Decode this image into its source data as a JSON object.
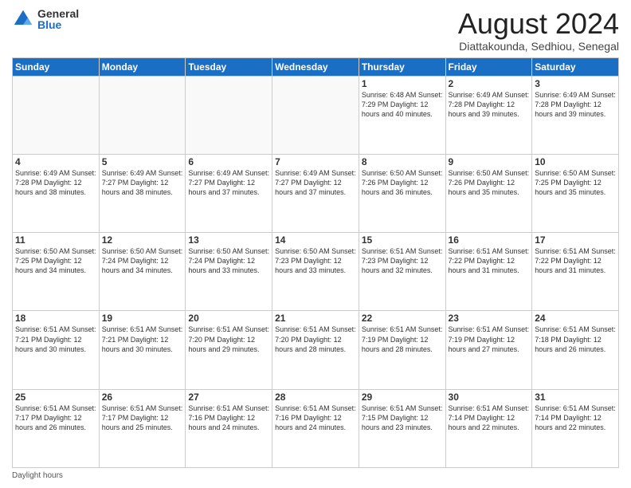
{
  "logo": {
    "general": "General",
    "blue": "Blue"
  },
  "title": "August 2024",
  "subtitle": "Diattakounda, Sedhiou, Senegal",
  "days_of_week": [
    "Sunday",
    "Monday",
    "Tuesday",
    "Wednesday",
    "Thursday",
    "Friday",
    "Saturday"
  ],
  "footer_label": "Daylight hours",
  "weeks": [
    [
      {
        "day": "",
        "info": ""
      },
      {
        "day": "",
        "info": ""
      },
      {
        "day": "",
        "info": ""
      },
      {
        "day": "",
        "info": ""
      },
      {
        "day": "1",
        "info": "Sunrise: 6:48 AM\nSunset: 7:29 PM\nDaylight: 12 hours\nand 40 minutes."
      },
      {
        "day": "2",
        "info": "Sunrise: 6:49 AM\nSunset: 7:28 PM\nDaylight: 12 hours\nand 39 minutes."
      },
      {
        "day": "3",
        "info": "Sunrise: 6:49 AM\nSunset: 7:28 PM\nDaylight: 12 hours\nand 39 minutes."
      }
    ],
    [
      {
        "day": "4",
        "info": "Sunrise: 6:49 AM\nSunset: 7:28 PM\nDaylight: 12 hours\nand 38 minutes."
      },
      {
        "day": "5",
        "info": "Sunrise: 6:49 AM\nSunset: 7:27 PM\nDaylight: 12 hours\nand 38 minutes."
      },
      {
        "day": "6",
        "info": "Sunrise: 6:49 AM\nSunset: 7:27 PM\nDaylight: 12 hours\nand 37 minutes."
      },
      {
        "day": "7",
        "info": "Sunrise: 6:49 AM\nSunset: 7:27 PM\nDaylight: 12 hours\nand 37 minutes."
      },
      {
        "day": "8",
        "info": "Sunrise: 6:50 AM\nSunset: 7:26 PM\nDaylight: 12 hours\nand 36 minutes."
      },
      {
        "day": "9",
        "info": "Sunrise: 6:50 AM\nSunset: 7:26 PM\nDaylight: 12 hours\nand 35 minutes."
      },
      {
        "day": "10",
        "info": "Sunrise: 6:50 AM\nSunset: 7:25 PM\nDaylight: 12 hours\nand 35 minutes."
      }
    ],
    [
      {
        "day": "11",
        "info": "Sunrise: 6:50 AM\nSunset: 7:25 PM\nDaylight: 12 hours\nand 34 minutes."
      },
      {
        "day": "12",
        "info": "Sunrise: 6:50 AM\nSunset: 7:24 PM\nDaylight: 12 hours\nand 34 minutes."
      },
      {
        "day": "13",
        "info": "Sunrise: 6:50 AM\nSunset: 7:24 PM\nDaylight: 12 hours\nand 33 minutes."
      },
      {
        "day": "14",
        "info": "Sunrise: 6:50 AM\nSunset: 7:23 PM\nDaylight: 12 hours\nand 33 minutes."
      },
      {
        "day": "15",
        "info": "Sunrise: 6:51 AM\nSunset: 7:23 PM\nDaylight: 12 hours\nand 32 minutes."
      },
      {
        "day": "16",
        "info": "Sunrise: 6:51 AM\nSunset: 7:22 PM\nDaylight: 12 hours\nand 31 minutes."
      },
      {
        "day": "17",
        "info": "Sunrise: 6:51 AM\nSunset: 7:22 PM\nDaylight: 12 hours\nand 31 minutes."
      }
    ],
    [
      {
        "day": "18",
        "info": "Sunrise: 6:51 AM\nSunset: 7:21 PM\nDaylight: 12 hours\nand 30 minutes."
      },
      {
        "day": "19",
        "info": "Sunrise: 6:51 AM\nSunset: 7:21 PM\nDaylight: 12 hours\nand 30 minutes."
      },
      {
        "day": "20",
        "info": "Sunrise: 6:51 AM\nSunset: 7:20 PM\nDaylight: 12 hours\nand 29 minutes."
      },
      {
        "day": "21",
        "info": "Sunrise: 6:51 AM\nSunset: 7:20 PM\nDaylight: 12 hours\nand 28 minutes."
      },
      {
        "day": "22",
        "info": "Sunrise: 6:51 AM\nSunset: 7:19 PM\nDaylight: 12 hours\nand 28 minutes."
      },
      {
        "day": "23",
        "info": "Sunrise: 6:51 AM\nSunset: 7:19 PM\nDaylight: 12 hours\nand 27 minutes."
      },
      {
        "day": "24",
        "info": "Sunrise: 6:51 AM\nSunset: 7:18 PM\nDaylight: 12 hours\nand 26 minutes."
      }
    ],
    [
      {
        "day": "25",
        "info": "Sunrise: 6:51 AM\nSunset: 7:17 PM\nDaylight: 12 hours\nand 26 minutes."
      },
      {
        "day": "26",
        "info": "Sunrise: 6:51 AM\nSunset: 7:17 PM\nDaylight: 12 hours\nand 25 minutes."
      },
      {
        "day": "27",
        "info": "Sunrise: 6:51 AM\nSunset: 7:16 PM\nDaylight: 12 hours\nand 24 minutes."
      },
      {
        "day": "28",
        "info": "Sunrise: 6:51 AM\nSunset: 7:16 PM\nDaylight: 12 hours\nand 24 minutes."
      },
      {
        "day": "29",
        "info": "Sunrise: 6:51 AM\nSunset: 7:15 PM\nDaylight: 12 hours\nand 23 minutes."
      },
      {
        "day": "30",
        "info": "Sunrise: 6:51 AM\nSunset: 7:14 PM\nDaylight: 12 hours\nand 22 minutes."
      },
      {
        "day": "31",
        "info": "Sunrise: 6:51 AM\nSunset: 7:14 PM\nDaylight: 12 hours\nand 22 minutes."
      }
    ]
  ]
}
